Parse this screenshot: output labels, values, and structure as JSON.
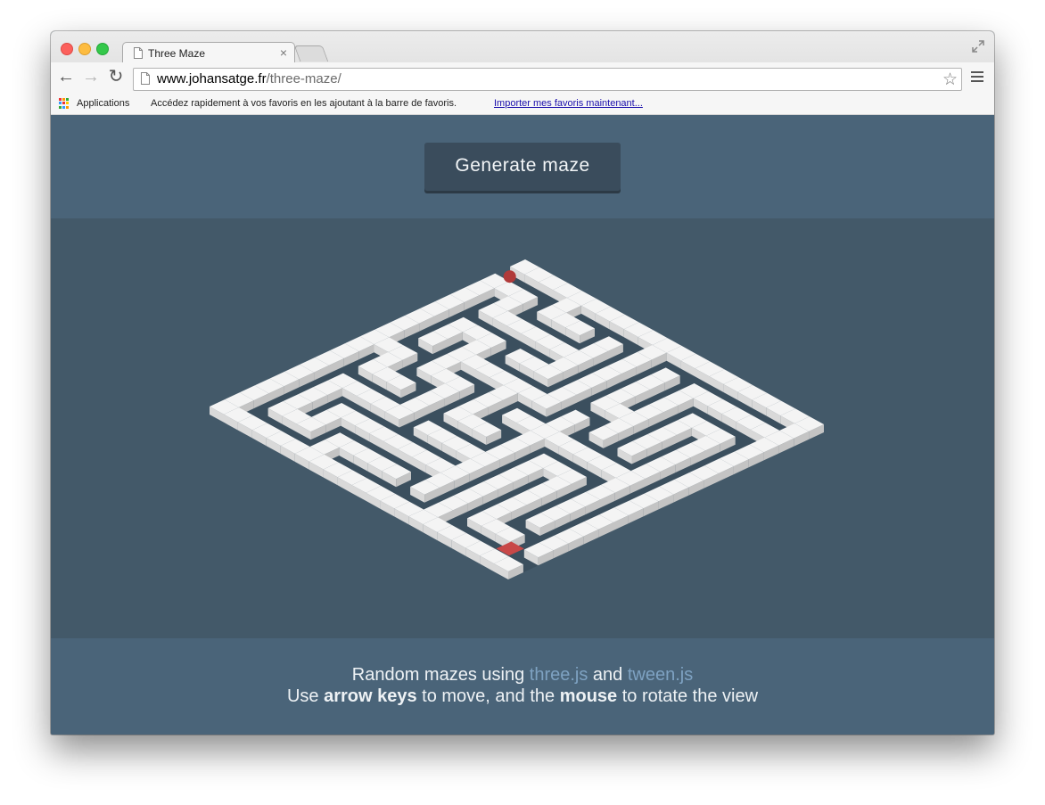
{
  "browser": {
    "tab_title": "Three Maze",
    "url_domain": "www.johansatge.fr",
    "url_path": "/three-maze/",
    "bookmarks": {
      "apps_label": "Applications",
      "message": "Accédez rapidement à vos favoris en les ajoutant à la barre de favoris.",
      "import_link": "Importer mes favoris maintenant..."
    }
  },
  "page": {
    "generate_button": "Generate maze",
    "footer": {
      "line1_prefix": "Random mazes using ",
      "link_threejs": "three.js",
      "line1_and": " and ",
      "link_tweenjs": "tween.js",
      "line2_prefix": "Use ",
      "arrow_keys": "arrow keys",
      "line2_middle": " to move, and the ",
      "mouse": "mouse",
      "line2_suffix": " to rotate the view"
    }
  },
  "colors": {
    "header_bg": "#4a6479",
    "maze_bg": "#435969",
    "button_bg": "#3a4c5c",
    "link": "#7ea2c2",
    "player": "#b13a3a",
    "exit": "#c84848",
    "wall_top": "#f4f4f4"
  },
  "icons": [
    "page-icon",
    "close-icon",
    "back-icon",
    "forward-icon",
    "reload-icon",
    "star-icon",
    "menu-icon",
    "apps-icon",
    "fullscreen-icon"
  ]
}
